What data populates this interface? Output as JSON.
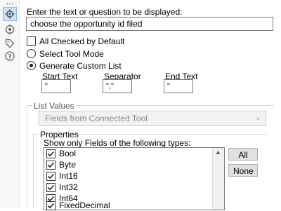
{
  "side_icons": [
    "gear-icon",
    "target-icon",
    "tag-icon",
    "help-icon"
  ],
  "prompt": {
    "label": "Enter the text or question to be displayed:",
    "value": "choose the opportunity id filed"
  },
  "options": {
    "all_checked_label": "All Checked by Default",
    "all_checked": false,
    "select_tool_mode_label": "Select Tool Mode",
    "generate_custom_list_label": "Generate Custom List",
    "selected_mode": "generate_custom_list"
  },
  "custom_list": {
    "start_text_label": "Start Text",
    "start_text_value": "\"",
    "separator_label": "Separator",
    "separator_value": "\",\"",
    "end_text_label": "End Text",
    "end_text_value": "\""
  },
  "list_values": {
    "label": "List Values",
    "selected": "Fields from Connected Tool"
  },
  "properties": {
    "label": "Properties",
    "filter_label": "Show only Fields of the following types:",
    "field_types": [
      {
        "name": "Bool",
        "checked": true
      },
      {
        "name": "Byte",
        "checked": true
      },
      {
        "name": "Int16",
        "checked": true
      },
      {
        "name": "Int32",
        "checked": true
      },
      {
        "name": "Int64",
        "checked": true
      },
      {
        "name": "FixedDecimal",
        "checked": true
      }
    ],
    "all_button": "All",
    "none_button": "None"
  }
}
